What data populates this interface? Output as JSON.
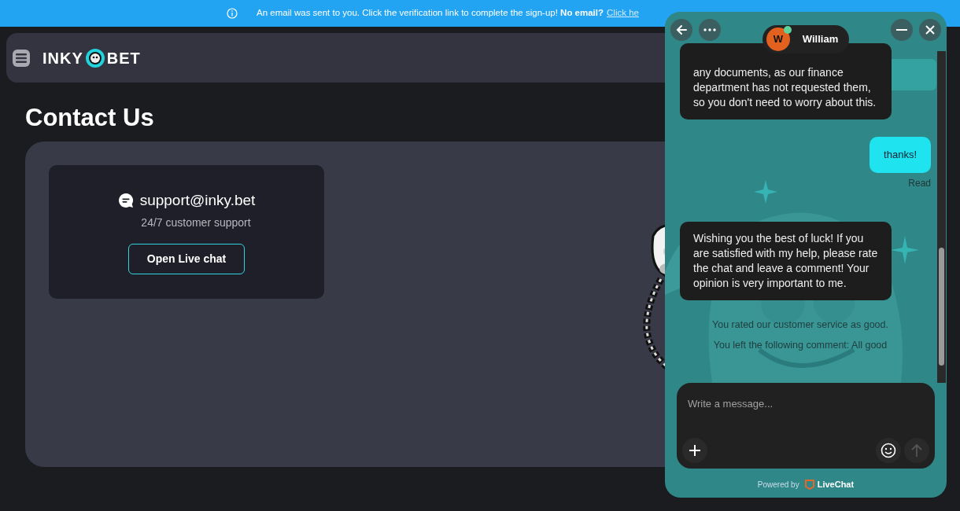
{
  "banner": {
    "text": "An email was sent to you. Click the verification link to complete the sign-up! **No email?**",
    "link": "Click he"
  },
  "header": {
    "logo": "INKY BET"
  },
  "page": {
    "title": "Contact Us",
    "contact": {
      "email": "support@inky.bet",
      "subtitle": "24/7 customer support",
      "button": "Open Live chat"
    }
  },
  "chat": {
    "agent": "William",
    "agent_initial": "W",
    "online": true,
    "messages": [
      {
        "kind": "agent",
        "text": "any documents, as our finance department has not requested them, so you don't need to worry about this."
      },
      {
        "kind": "visitor",
        "text": "thanks!",
        "status": "Read"
      },
      {
        "kind": "agent",
        "text": "Wishing you the best of luck! If you are satisfied with my help, please rate the chat and leave a comment! Your opinion is very important to me."
      },
      {
        "kind": "system",
        "text": "You rated our customer service as good."
      },
      {
        "kind": "system",
        "text": "You left the following comment: All good"
      }
    ],
    "composer": {
      "placeholder": "Write a message..."
    },
    "footer": {
      "prefix": "Powered by",
      "brand": "LiveChat"
    }
  }
}
